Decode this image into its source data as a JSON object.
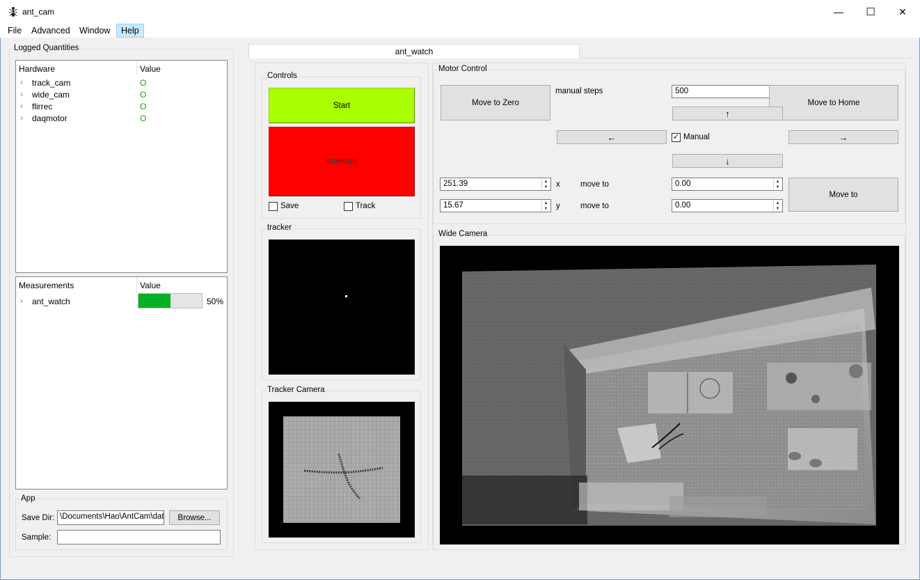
{
  "window": {
    "title": "ant_cam",
    "minimize": "—",
    "maximize": "☐",
    "close": "✕"
  },
  "menu": [
    "File",
    "Advanced",
    "Window",
    "Help"
  ],
  "logged": {
    "title": "Logged Quantities",
    "hardware_header": "Hardware",
    "value_header": "Value",
    "hardware": [
      {
        "name": "track_cam",
        "value": "O"
      },
      {
        "name": "wide_cam",
        "value": "O"
      },
      {
        "name": "flirrec",
        "value": "O"
      },
      {
        "name": "daqmotor",
        "value": "O"
      }
    ],
    "measurements_header": "Measurements",
    "measurements": [
      {
        "name": "ant_watch",
        "progress": 50,
        "progress_text": "50%"
      }
    ]
  },
  "app": {
    "title": "App",
    "save_dir_label": "Save Dir:",
    "save_dir_value": "\\Documents\\Hao\\AntCam\\data",
    "browse": "Browse...",
    "sample_label": "Sample:",
    "sample_value": ""
  },
  "tab": {
    "label": "ant_watch"
  },
  "controls": {
    "title": "Controls",
    "start": "Start",
    "interrupt": "Interrupt",
    "save": "Save",
    "track": "Track",
    "start_color": "#aaff00",
    "interrupt_color": "#ff0000"
  },
  "tracker": {
    "title": "tracker"
  },
  "tracker_camera": {
    "title": "Tracker Camera"
  },
  "motor": {
    "title": "Motor Control",
    "move_to_zero": "Move to Zero",
    "manual_steps_label": "manual steps",
    "manual_steps_value": "500",
    "move_to_home": "Move to Home",
    "up": "↑",
    "left": "←",
    "right": "→",
    "down": "↓",
    "manual_label": "Manual",
    "manual_checked": "✓",
    "x_value": "251.39",
    "x_label": "x",
    "x_moveto_label": "move to",
    "x_target": "0.00",
    "y_value": "15.67",
    "y_label": "y",
    "y_moveto_label": "move to",
    "y_target": "0.00",
    "move_to": "Move to"
  },
  "wide_camera": {
    "title": "Wide Camera"
  }
}
